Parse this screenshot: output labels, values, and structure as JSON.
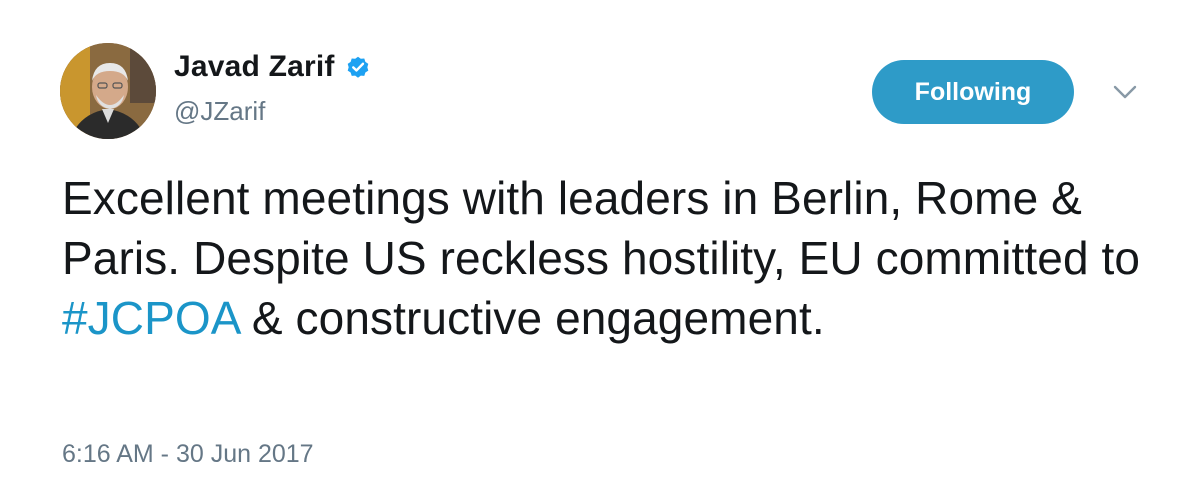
{
  "user": {
    "display_name": "Javad Zarif",
    "handle": "@JZarif",
    "verified": true
  },
  "follow_button": {
    "label": "Following",
    "color": "#2e9bc8"
  },
  "icons": {
    "verified": "verified-badge-icon",
    "menu": "chevron-down-icon"
  },
  "tweet": {
    "text_before": "Excellent meetings with leaders in Berlin, Rome & Paris. Despite US reckless hostility, EU committed to ",
    "hashtag": "#JCPOA",
    "text_after": " & constructive engagement.",
    "hashtag_color": "#1b95c8"
  },
  "timestamp": "6:16 AM - 30 Jun 2017"
}
